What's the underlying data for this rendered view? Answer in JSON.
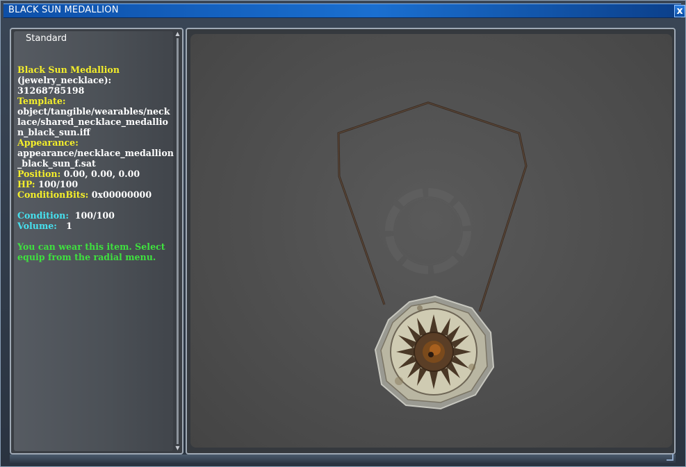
{
  "window": {
    "title": "BLACK SUN MEDALLION",
    "close_glyph": "x"
  },
  "tab": {
    "label": "Standard"
  },
  "item": {
    "name": "Black Sun Medallion",
    "type_line": "(jewelry_necklace):",
    "id": "31268785198",
    "template_label": "Template:",
    "template_lines": [
      "object/tangible/wearables/neck",
      "lace/shared_necklace_medallio",
      "n_black_sun.iff"
    ],
    "appearance_label": "Appearance:",
    "appearance_lines": [
      "appearance/necklace_medallion",
      "_black_sun_f.sat"
    ],
    "position_label": "Position:",
    "position_value": "0.00, 0.00, 0.00",
    "hp_label": "HP:",
    "hp_value": "100/100",
    "conditionbits_label": "ConditionBits:",
    "conditionbits_value": "0x00000000",
    "condition_label": "Condition:",
    "condition_value": "100/100",
    "volume_label": "Volume:",
    "volume_value": "1",
    "wear_lines": [
      "You can wear this item.  Select",
      "equip from the radial menu."
    ]
  },
  "icons": {
    "close": "close-icon",
    "scroll_up": "scroll-up-arrow-icon",
    "scroll_down": "scroll-down-arrow-icon",
    "medallion": "black-sun-medallion-model"
  },
  "colors": {
    "title_bar": "#1a6fd0",
    "label_yellow": "#f4ee2a",
    "label_cyan": "#46e0ee",
    "hint_green": "#3fe03f"
  }
}
